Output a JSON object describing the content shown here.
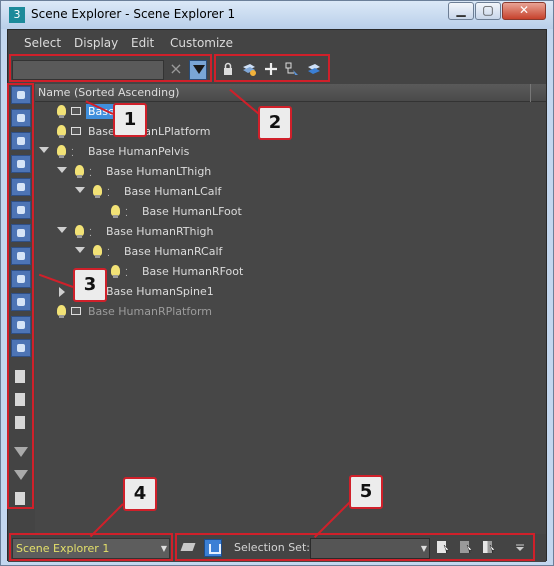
{
  "window": {
    "title": "Scene Explorer - Scene Explorer 1",
    "app_icon": "3",
    "min_label": "▁",
    "max_label": "▢",
    "close_label": "✕"
  },
  "menu": [
    "Select",
    "Display",
    "Edit",
    "Customize"
  ],
  "search": {
    "value": "",
    "clear_icon": "×"
  },
  "toolbar_icons": [
    "lock-icon",
    "add-layer-icon",
    "plus-icon",
    "link-icon",
    "select-layer-icon"
  ],
  "left_toolbar_icons": [
    "display-all-icon",
    "display-geometry-icon",
    "display-shapes-icon",
    "display-lights-icon",
    "display-cameras-icon",
    "display-helpers-icon",
    "display-spacewarps-icon",
    "display-groups-icon",
    "display-bones-icon",
    "display-xrefs-icon",
    "display-containers-icon",
    "display-frozen-icon",
    "display-all-page-icon",
    "display-none-page-icon",
    "display-invert-page-icon",
    "filter-icon",
    "filter-settings-icon",
    "collapse-icon"
  ],
  "tree": {
    "column_header": "Name (Sorted Ascending)",
    "rows": [
      {
        "label": "Base",
        "selected": true
      },
      {
        "label": "Base HumanLPlatform"
      },
      {
        "label": "Base HumanPelvis"
      },
      {
        "label": "Base HumanLThigh"
      },
      {
        "label": "Base HumanLCalf"
      },
      {
        "label": "Base HumanLFoot"
      },
      {
        "label": "Base HumanRThigh"
      },
      {
        "label": "Base HumanRCalf"
      },
      {
        "label": "Base HumanRFoot"
      },
      {
        "label": "Base HumanSpine1"
      },
      {
        "label": "Base HumanRPlatform"
      }
    ]
  },
  "bottom": {
    "explorer_name": "Scene Explorer 1",
    "selection_set_label": "Selection Set:",
    "selection_set_value": ""
  },
  "callouts": [
    "1",
    "2",
    "3",
    "4",
    "5"
  ],
  "colors": {
    "callout_border": "#d0202a",
    "selection": "#3f8fdc",
    "explorer_name": "#e4e06a",
    "panel": "#444444"
  }
}
